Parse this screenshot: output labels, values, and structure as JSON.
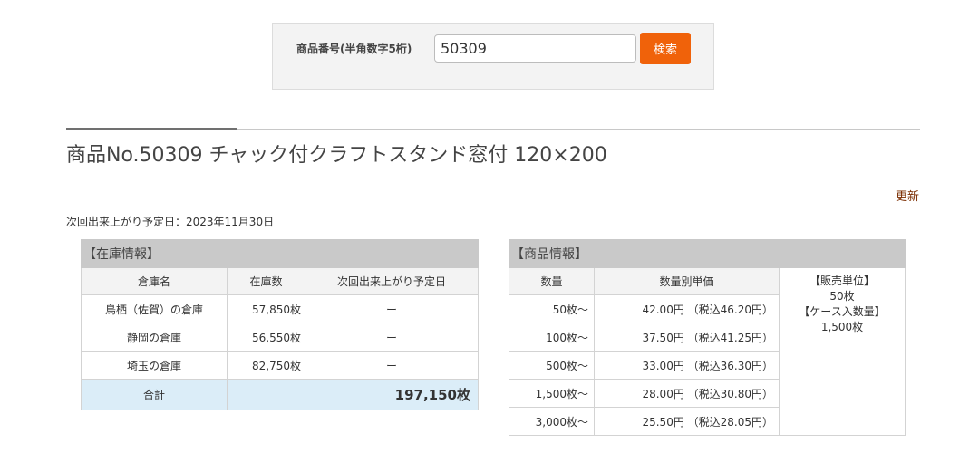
{
  "search": {
    "label": "商品番号(半角数字5桁)",
    "value": "50309",
    "button_label": "検索"
  },
  "product": {
    "title": "商品No.50309 チャック付クラフトスタンド窓付 120×200",
    "refresh_label": "更新",
    "next_date": "次回出来上がり予定日：2023年11月30日"
  },
  "stock": {
    "caption": "【在庫情報】",
    "headers": [
      "倉庫名",
      "在庫数",
      "次回出来上がり予定日"
    ],
    "rows": [
      {
        "name": "鳥栖（佐賀）の倉庫",
        "qty": "57,850枚",
        "date": "ー"
      },
      {
        "name": "静岡の倉庫",
        "qty": "56,550枚",
        "date": "ー"
      },
      {
        "name": "埼玉の倉庫",
        "qty": "82,750枚",
        "date": "ー"
      }
    ],
    "total_label": "合計",
    "total_value": "197,150枚"
  },
  "pricing": {
    "caption": "【商品情報】",
    "headers": [
      "数量",
      "数量別単価"
    ],
    "rows": [
      {
        "qty": "50枚～",
        "price": "42.00円 （税込46.20円）"
      },
      {
        "qty": "100枚～",
        "price": "37.50円 （税込41.25円）"
      },
      {
        "qty": "500枚～",
        "price": "33.00円 （税込36.30円）"
      },
      {
        "qty": "1,500枚～",
        "price": "28.00円 （税込30.80円）"
      },
      {
        "qty": "3,000枚～",
        "price": "25.50円 （税込28.05円）"
      }
    ],
    "info": {
      "unit_label": "【販売単位】",
      "unit_value": "50枚",
      "case_label": "【ケース入数量】",
      "case_value": "1,500枚"
    }
  }
}
